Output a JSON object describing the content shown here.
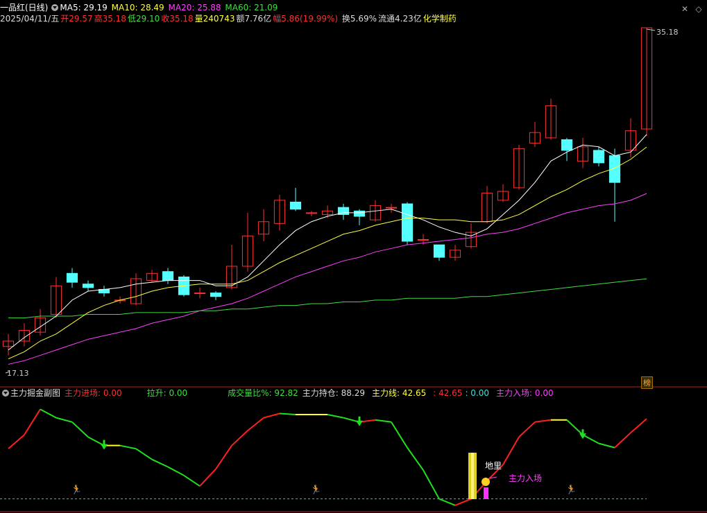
{
  "header": {
    "stock_name": "一品红(日线)",
    "ma5": {
      "label": "MA5: 29.19",
      "color": "#ffffff"
    },
    "ma10": {
      "label": "MA10: 28.49",
      "color": "#ffff40"
    },
    "ma20": {
      "label": "MA20: 25.88",
      "color": "#ff40ff"
    },
    "ma60": {
      "label": "MA60: 21.09",
      "color": "#40e040"
    },
    "date": "2025/04/11/五",
    "open": "开29.57",
    "high": "高35.18",
    "low": "低29.10",
    "close": "收35.18",
    "volume": "量240743",
    "amount": "额7.76亿",
    "change": "幅5.86(19.99%)",
    "turnover": "换5.69%",
    "float_cap": "流通4.23亿",
    "sector": "化学制药"
  },
  "price_labels": {
    "high": "35.18",
    "low": "17.13"
  },
  "badge": "榜",
  "sub_header": {
    "title": "主力掘金副图",
    "items": [
      {
        "label": "主力进场: 0.00",
        "color": "#ff3030"
      },
      {
        "label": "拉升: 0.00",
        "color": "#40e040"
      },
      {
        "label": "成交量比%: 92.82",
        "color": "#40e040"
      },
      {
        "label": "主力持仓: 88.29",
        "color": "#dddddd"
      },
      {
        "label": "主力线: 42.65",
        "color": "#ffff40"
      },
      {
        "label": ": 42.65",
        "color": "#ff3030"
      },
      {
        "label": ": 0.00",
        "color": "#40e0e0"
      },
      {
        "label": "主力入场: 0.00",
        "color": "#ff40ff"
      }
    ]
  },
  "annotations": {
    "dili": "地里",
    "zhuli_ruchang": "主力入场"
  },
  "chart_data": {
    "type": "candlestick",
    "price_axis_range": [
      17.13,
      35.18
    ],
    "candles": [
      [
        17.3,
        17.6,
        16.8,
        18.0
      ],
      [
        17.6,
        18.2,
        17.3,
        18.6
      ],
      [
        18.1,
        18.9,
        17.9,
        19.4
      ],
      [
        19.1,
        20.7,
        18.9,
        21.2
      ],
      [
        21.4,
        20.9,
        20.6,
        21.7
      ],
      [
        20.8,
        20.6,
        20.4,
        21.0
      ],
      [
        20.5,
        20.3,
        20.1,
        20.7
      ],
      [
        19.9,
        19.9,
        19.7,
        20.1
      ],
      [
        19.7,
        21.1,
        19.6,
        21.4
      ],
      [
        21.0,
        21.4,
        20.9,
        21.6
      ],
      [
        21.5,
        21.0,
        20.8,
        21.7
      ],
      [
        21.2,
        20.2,
        20.1,
        21.3
      ],
      [
        20.3,
        20.3,
        20.0,
        20.6
      ],
      [
        20.3,
        20.1,
        19.9,
        20.4
      ],
      [
        20.6,
        21.8,
        20.5,
        23.0
      ],
      [
        21.8,
        23.5,
        21.5,
        24.8
      ],
      [
        23.6,
        24.3,
        23.2,
        25.0
      ],
      [
        24.2,
        25.5,
        23.8,
        25.8
      ],
      [
        25.4,
        25.0,
        24.9,
        26.2
      ],
      [
        24.8,
        24.8,
        24.6,
        24.9
      ],
      [
        24.7,
        24.9,
        24.5,
        25.2
      ],
      [
        25.1,
        24.7,
        24.4,
        25.3
      ],
      [
        24.9,
        24.6,
        24.1,
        25.0
      ],
      [
        24.4,
        25.2,
        24.3,
        25.5
      ],
      [
        25.1,
        25.1,
        24.8,
        25.3
      ],
      [
        25.3,
        23.2,
        23.0,
        25.4
      ],
      [
        23.3,
        23.3,
        23.0,
        23.6
      ],
      [
        23.0,
        22.3,
        22.1,
        23.0
      ],
      [
        22.3,
        22.7,
        22.1,
        23.0
      ],
      [
        22.9,
        23.7,
        22.8,
        24.2
      ],
      [
        24.3,
        25.9,
        24.2,
        26.3
      ],
      [
        25.5,
        26.0,
        25.4,
        26.4
      ],
      [
        26.2,
        28.4,
        26.1,
        28.6
      ],
      [
        28.7,
        29.3,
        28.5,
        29.9
      ],
      [
        29.0,
        30.8,
        28.9,
        31.2
      ],
      [
        28.9,
        28.3,
        27.7,
        29.0
      ],
      [
        27.7,
        28.5,
        27.3,
        29.0
      ],
      [
        28.3,
        27.6,
        27.4,
        28.5
      ],
      [
        28.0,
        26.5,
        24.3,
        28.4
      ],
      [
        28.3,
        29.4,
        27.9,
        30.1
      ],
      [
        29.5,
        35.18,
        29.1,
        35.18
      ]
    ],
    "ma5": [
      17.1,
      17.8,
      18.4,
      19.0,
      19.9,
      20.4,
      20.5,
      20.6,
      20.8,
      20.9,
      21.0,
      21.0,
      21.0,
      20.7,
      20.7,
      21.2,
      22.1,
      23.0,
      23.8,
      24.3,
      24.6,
      24.8,
      24.8,
      24.9,
      25.0,
      24.7,
      24.4,
      24.0,
      23.7,
      23.5,
      23.9,
      24.7,
      25.5,
      26.5,
      27.7,
      28.2,
      28.6,
      28.5,
      28.0,
      28.2,
      29.19
    ],
    "ma10": [
      16.6,
      17.0,
      17.6,
      18.0,
      18.6,
      19.2,
      19.6,
      19.9,
      20.1,
      20.4,
      20.6,
      20.7,
      20.8,
      20.8,
      20.8,
      21.0,
      21.5,
      22.0,
      22.4,
      22.8,
      23.2,
      23.6,
      23.8,
      24.1,
      24.3,
      24.5,
      24.5,
      24.4,
      24.4,
      24.3,
      24.3,
      24.4,
      24.7,
      25.2,
      25.7,
      26.1,
      26.6,
      27.0,
      27.3,
      27.8,
      28.49
    ],
    "ma20": [
      16.3,
      16.5,
      16.8,
      17.1,
      17.4,
      17.7,
      17.9,
      18.1,
      18.3,
      18.6,
      18.8,
      19.0,
      19.3,
      19.5,
      19.7,
      20.0,
      20.4,
      20.8,
      21.2,
      21.5,
      21.8,
      22.1,
      22.3,
      22.6,
      22.8,
      23.0,
      23.1,
      23.2,
      23.3,
      23.4,
      23.6,
      23.7,
      23.9,
      24.2,
      24.5,
      24.8,
      25.0,
      25.2,
      25.3,
      25.5,
      25.88
    ],
    "ma60": [
      18.9,
      18.9,
      19.0,
      19.0,
      19.0,
      19.1,
      19.1,
      19.1,
      19.2,
      19.2,
      19.2,
      19.2,
      19.3,
      19.3,
      19.4,
      19.4,
      19.5,
      19.6,
      19.6,
      19.7,
      19.7,
      19.8,
      19.8,
      19.9,
      19.9,
      20.0,
      20.0,
      20.0,
      20.0,
      20.1,
      20.1,
      20.2,
      20.3,
      20.4,
      20.5,
      20.6,
      20.7,
      20.8,
      20.9,
      21.0,
      21.09
    ],
    "sub_line": [
      55,
      68,
      92,
      84,
      80,
      66,
      58,
      58,
      55,
      45,
      38,
      30,
      20,
      36,
      58,
      72,
      84,
      88,
      87,
      87,
      87,
      84,
      80,
      82,
      80,
      56,
      35,
      8,
      2,
      8,
      25,
      40,
      66,
      80,
      82,
      82,
      68,
      60,
      56,
      70,
      83
    ]
  }
}
